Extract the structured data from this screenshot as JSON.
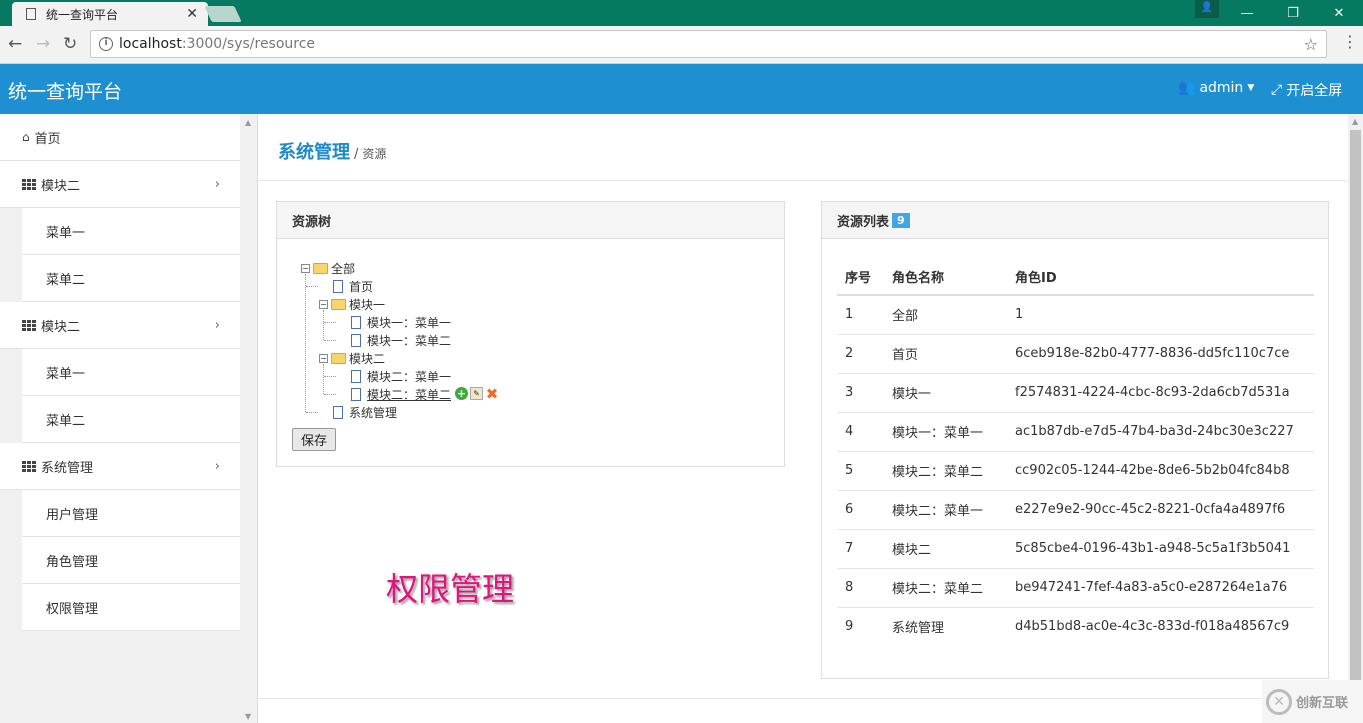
{
  "browser": {
    "tab_title": "统一查询平台",
    "url_host": "localhost",
    "url_path": ":3000/sys/resource"
  },
  "header": {
    "brand": "统一查询平台",
    "user": "admin",
    "fullscreen": "开启全屏",
    "bg_color": "#1e90d2"
  },
  "sidebar": {
    "home": "首页",
    "groups": [
      {
        "label": "模块二",
        "items": [
          "菜单一",
          "菜单二"
        ]
      },
      {
        "label": "模块二",
        "items": [
          "菜单一",
          "菜单二"
        ]
      },
      {
        "label": "系统管理",
        "items": [
          "用户管理",
          "角色管理",
          "权限管理"
        ]
      }
    ]
  },
  "breadcrumb": {
    "main": "系统管理",
    "sep": "/",
    "sub": "资源"
  },
  "tree_panel": {
    "title": "资源树",
    "nodes": {
      "root": "全部",
      "home": "首页",
      "m1": "模块一",
      "m1a": "模块一：菜单一",
      "m1b": "模块一：菜单二",
      "m2": "模块二",
      "m2a": "模块二：菜单一",
      "m2b": "模块二：菜单二",
      "sys": "系统管理"
    },
    "save": "保存"
  },
  "watermark": "权限管理",
  "list_panel": {
    "title": "资源列表",
    "count": "9",
    "columns": [
      "序号",
      "角色名称",
      "角色ID"
    ],
    "rows": [
      [
        "1",
        "全部",
        "1"
      ],
      [
        "2",
        "首页",
        "6ceb918e-82b0-4777-8836-dd5fc110c7ce"
      ],
      [
        "3",
        "模块一",
        "f2574831-4224-4cbc-8c93-2da6cb7d531a"
      ],
      [
        "4",
        "模块一：菜单一",
        "ac1b87db-e7d5-47b4-ba3d-24bc30e3c227"
      ],
      [
        "5",
        "模块二：菜单二",
        "cc902c05-1244-42be-8de6-5b2b04fc84b8"
      ],
      [
        "6",
        "模块二：菜单一",
        "e227e9e2-90cc-45c2-8221-0cfa4a4897f6"
      ],
      [
        "7",
        "模块二",
        "5c85cbe4-0196-43b1-a948-5c5a1f3b5041"
      ],
      [
        "8",
        "模块二：菜单二",
        "be947241-7fef-4a83-a5c0-e287264e1a76"
      ],
      [
        "9",
        "系统管理",
        "d4b51bd8-ac0e-4c3c-833d-f018a48567c9"
      ]
    ]
  },
  "logo_text": "创新互联"
}
